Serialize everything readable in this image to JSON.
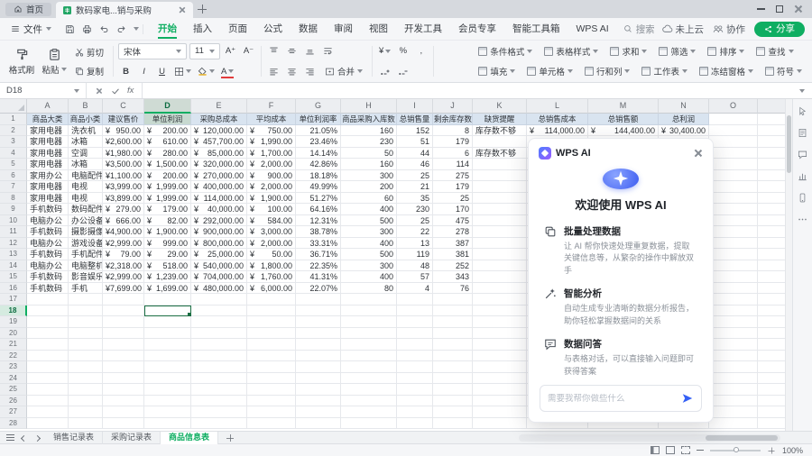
{
  "titlebar": {
    "home_tab": "首页",
    "doc_title": "数码家电...销与采购"
  },
  "menubar": {
    "file": "文件",
    "tabs": [
      "开始",
      "插入",
      "页面",
      "公式",
      "数据",
      "审阅",
      "视图",
      "开发工具",
      "会员专享",
      "智能工具箱",
      "WPS AI"
    ],
    "active_tab": "开始",
    "search": "搜索",
    "cloud_status": "未上云",
    "collab": "协作",
    "share": "分享"
  },
  "toolbar": {
    "format_painter": "格式刷",
    "paste": "粘贴",
    "cut": "剪切",
    "copy": "复制",
    "font_family": "宋体",
    "font_size": "11",
    "grow_font": "A⁺",
    "shrink_font": "A⁻",
    "bold": "B",
    "italic": "I",
    "underline": "U",
    "font_color": "A",
    "merge": "合并",
    "currency": "¥",
    "percent": "%",
    "comma": ",",
    "row1_buttons": [
      "条件格式",
      "表格样式",
      "求和",
      "筛选",
      "排序",
      "查找"
    ],
    "row2_buttons": [
      "填充",
      "单元格",
      "行和列",
      "工作表",
      "冻结窗格",
      "符号"
    ]
  },
  "formula_bar": {
    "name_box": "D18",
    "fx": "fx"
  },
  "sheet": {
    "col_letters": [
      "A",
      "B",
      "C",
      "D",
      "E",
      "F",
      "G",
      "H",
      "I",
      "J",
      "K",
      "L",
      "M",
      "N",
      "O"
    ],
    "visible_rows": 28,
    "selected_cell": "D18",
    "headers": [
      "商品大类",
      "商品小类",
      "建议售价",
      "单位利润",
      "采购总成本",
      "平均成本",
      "单位利润率",
      "商品采购入库数",
      "总销售量",
      "剩余库存数",
      "缺货提醒",
      "总销售成本",
      "总销售额",
      "总利润"
    ],
    "rows": [
      [
        "家用电器",
        "洗衣机",
        "¥950.00",
        "¥200.00",
        "¥120,000.00",
        "¥750.00",
        "21.05%",
        "160",
        "152",
        "8",
        "库存数不够",
        "¥114,000.00",
        "¥144,400.00",
        "¥30,400.00"
      ],
      [
        "家用电器",
        "冰箱",
        "¥2,600.00",
        "¥610.00",
        "¥457,700.00",
        "¥1,990.00",
        "23.46%",
        "230",
        "51",
        "179",
        "",
        "",
        "",
        ""
      ],
      [
        "家用电器",
        "空调",
        "¥1,980.00",
        "¥280.00",
        "¥85,000.00",
        "¥1,700.00",
        "14.14%",
        "50",
        "44",
        "6",
        "库存数不够",
        "",
        "",
        ""
      ],
      [
        "家用电器",
        "冰箱",
        "¥3,500.00",
        "¥1,500.00",
        "¥320,000.00",
        "¥2,000.00",
        "42.86%",
        "160",
        "46",
        "114",
        "",
        "",
        "",
        ""
      ],
      [
        "家用办公",
        "电脑配件",
        "¥1,100.00",
        "¥200.00",
        "¥270,000.00",
        "¥900.00",
        "18.18%",
        "300",
        "25",
        "275",
        "",
        "",
        "",
        ""
      ],
      [
        "家用电器",
        "电视",
        "¥3,999.00",
        "¥1,999.00",
        "¥400,000.00",
        "¥2,000.00",
        "49.99%",
        "200",
        "21",
        "179",
        "",
        "",
        "",
        ""
      ],
      [
        "家用电器",
        "电视",
        "¥3,899.00",
        "¥1,999.00",
        "¥114,000.00",
        "¥1,900.00",
        "51.27%",
        "60",
        "35",
        "25",
        "",
        "",
        "",
        ""
      ],
      [
        "手机数码",
        "数码配件",
        "¥279.00",
        "¥179.00",
        "¥40,000.00",
        "¥100.00",
        "64.16%",
        "400",
        "230",
        "170",
        "",
        "",
        "",
        ""
      ],
      [
        "电脑办公",
        "办公设备",
        "¥666.00",
        "¥82.00",
        "¥292,000.00",
        "¥584.00",
        "12.31%",
        "500",
        "25",
        "475",
        "",
        "",
        "",
        ""
      ],
      [
        "手机数码",
        "摄影摄像",
        "¥4,900.00",
        "¥1,900.00",
        "¥900,000.00",
        "¥3,000.00",
        "38.78%",
        "300",
        "22",
        "278",
        "",
        "",
        "",
        ""
      ],
      [
        "电脑办公",
        "游戏设备",
        "¥2,999.00",
        "¥999.00",
        "¥800,000.00",
        "¥2,000.00",
        "33.31%",
        "400",
        "13",
        "387",
        "",
        "",
        "",
        ""
      ],
      [
        "手机数码",
        "手机配件",
        "¥79.00",
        "¥29.00",
        "¥25,000.00",
        "¥50.00",
        "36.71%",
        "500",
        "119",
        "381",
        "",
        "",
        "",
        ""
      ],
      [
        "电脑办公",
        "电脑整机",
        "¥2,318.00",
        "¥518.00",
        "¥540,000.00",
        "¥1,800.00",
        "22.35%",
        "300",
        "48",
        "252",
        "",
        "",
        "",
        ""
      ],
      [
        "手机数码",
        "影音娱乐",
        "¥2,999.00",
        "¥1,239.00",
        "¥704,000.00",
        "¥1,760.00",
        "41.31%",
        "400",
        "57",
        "343",
        "",
        "",
        "",
        ""
      ],
      [
        "手机数码",
        "手机",
        "¥7,699.00",
        "¥1,699.00",
        "¥480,000.00",
        "¥6,000.00",
        "22.07%",
        "80",
        "4",
        "76",
        "",
        "",
        "",
        ""
      ]
    ]
  },
  "ai_panel": {
    "title": "WPS AI",
    "welcome": "欢迎使用 WPS AI",
    "features": [
      {
        "title": "批量处理数据",
        "desc": "让 AI 帮你快速处理重复数据，提取关键信息等，从繁杂的操作中解放双手"
      },
      {
        "title": "智能分析",
        "desc": "自动生成专业清晰的数据分析报告，助你轻松掌握数据间的关系"
      },
      {
        "title": "数据问答",
        "desc": "与表格对话，可以直接输入问题即可获得答案"
      }
    ],
    "input_placeholder": "需要我帮你做些什么"
  },
  "sheet_tabs": {
    "tabs": [
      "销售记录表",
      "采购记录表",
      "商品信息表"
    ],
    "active": "商品信息表"
  },
  "status_bar": {
    "zoom": "100%"
  }
}
